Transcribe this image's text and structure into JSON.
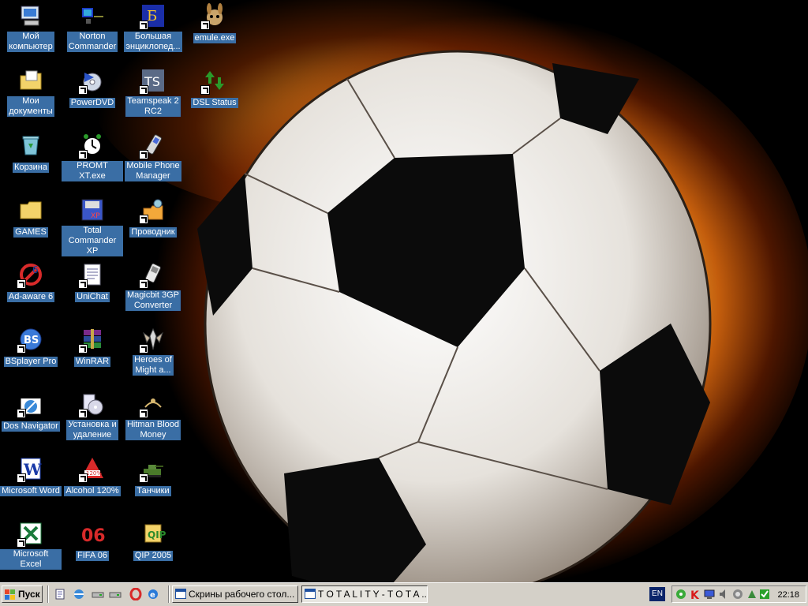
{
  "desktop": {
    "icons": [
      {
        "label": "Мой\nкомпьютер",
        "icon": "my-computer-icon",
        "shortcut": false
      },
      {
        "label": "Norton\nCommander",
        "icon": "norton-commander-icon",
        "shortcut": false
      },
      {
        "label": "Большая\nэнциклопед...",
        "icon": "encyclopedia-icon",
        "shortcut": true
      },
      {
        "label": "emule.exe",
        "icon": "emule-icon",
        "shortcut": true
      },
      {
        "label": "Мои\nдокументы",
        "icon": "my-documents-icon",
        "shortcut": false
      },
      {
        "label": "PowerDVD",
        "icon": "powerdvd-icon",
        "shortcut": true
      },
      {
        "label": "Teamspeak 2\nRC2",
        "icon": "teamspeak-icon",
        "shortcut": true
      },
      {
        "label": "DSL Status",
        "icon": "dsl-status-icon",
        "shortcut": true
      },
      {
        "label": "Корзина",
        "icon": "recycle-bin-icon",
        "shortcut": false
      },
      {
        "label": "PROMT XT.exe",
        "icon": "promt-icon",
        "shortcut": true
      },
      {
        "label": "Mobile Phone\nManager",
        "icon": "mobile-phone-manager-icon",
        "shortcut": true
      },
      {
        "label": "GAMES",
        "icon": "folder-icon",
        "shortcut": false
      },
      {
        "label": "Total\nCommander XP",
        "icon": "total-commander-icon",
        "shortcut": false
      },
      {
        "label": "Проводник",
        "icon": "explorer-icon",
        "shortcut": true
      },
      {
        "label": "Ad-aware 6",
        "icon": "adaware-icon",
        "shortcut": true
      },
      {
        "label": "UniChat",
        "icon": "unichat-icon",
        "shortcut": true
      },
      {
        "label": "Magicbit 3GP\nConverter",
        "icon": "magicbit-icon",
        "shortcut": true
      },
      {
        "label": "BSplayer Pro",
        "icon": "bsplayer-icon",
        "shortcut": true
      },
      {
        "label": "WinRAR",
        "icon": "winrar-icon",
        "shortcut": true
      },
      {
        "label": "Heroes of\nMight a...",
        "icon": "heroes-icon",
        "shortcut": true
      },
      {
        "label": "Dos Navigator",
        "icon": "dos-navigator-icon",
        "shortcut": true
      },
      {
        "label": "Установка и\nудаление",
        "icon": "add-remove-programs-icon",
        "shortcut": true
      },
      {
        "label": "Hitman Blood\nMoney",
        "icon": "hitman-icon",
        "shortcut": true
      },
      {
        "label": "Microsoft Word",
        "icon": "word-icon",
        "shortcut": true
      },
      {
        "label": "Alcohol 120%",
        "icon": "alcohol-icon",
        "shortcut": true
      },
      {
        "label": "Танчики",
        "icon": "tanks-icon",
        "shortcut": true
      },
      {
        "label": "Microsoft Excel",
        "icon": "excel-icon",
        "shortcut": true
      },
      {
        "label": "FIFA 06",
        "icon": "fifa-icon",
        "shortcut": false
      },
      {
        "label": "QIP 2005",
        "icon": "qip-icon",
        "shortcut": false
      }
    ]
  },
  "taskbar": {
    "start_label": "Пуск",
    "quick_launch": [
      "notepad-icon",
      "ie-settings-icon",
      "drive-icon",
      "drive-icon",
      "opera-icon",
      "internet-explorer-icon"
    ],
    "tasks": [
      {
        "label": "Скрины рабочего стол...",
        "active": false
      },
      {
        "label": "T O T A L I T Y - T O T A ...",
        "active": true
      }
    ],
    "language": "EN",
    "tray_icons": [
      "network-icon",
      "kaspersky-icon",
      "monitor-icon",
      "volume-icon",
      "update-icon",
      "network-activity-icon",
      "green-check-icon",
      "dsl-icon"
    ],
    "clock": "22:18"
  },
  "colors": {
    "label_bg": "#3a6ea5",
    "taskbar_bg": "#d4d0c8",
    "active_language_bg": "#0a246a"
  }
}
